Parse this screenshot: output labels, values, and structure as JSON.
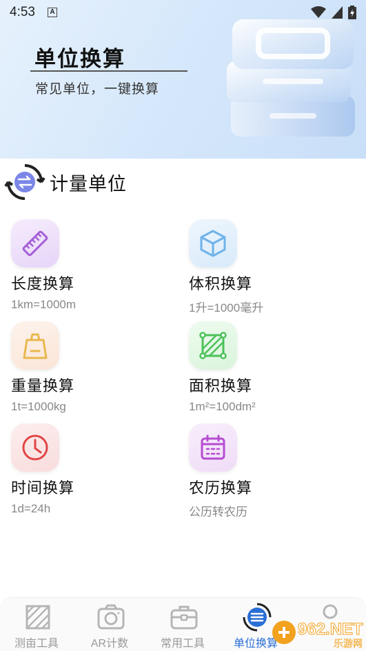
{
  "status_bar": {
    "time": "4:53",
    "notification_icon": "A"
  },
  "hero": {
    "title": "单位换算",
    "subtitle": "常见单位，一键换算"
  },
  "section": {
    "title": "计量单位"
  },
  "tools": [
    {
      "name": "长度换算",
      "desc": "1km=1000m",
      "icon": "ruler-icon",
      "color": "#a45fd6"
    },
    {
      "name": "体积换算",
      "desc": "1升=1000毫升",
      "icon": "cube-icon",
      "color": "#6fb3ea"
    },
    {
      "name": "重量换算",
      "desc": "1t=1000kg",
      "icon": "weight-bag-icon",
      "color": "#e8b84c"
    },
    {
      "name": "面积换算",
      "desc": "1m²=100dm²",
      "icon": "area-square-icon",
      "color": "#4cc25a"
    },
    {
      "name": "时间换算",
      "desc": "1d=24h",
      "icon": "clock-icon",
      "color": "#e04545"
    },
    {
      "name": "农历换算",
      "desc": "公历转农历",
      "icon": "calendar-icon",
      "color": "#b54dd0"
    }
  ],
  "bottom_nav": [
    {
      "label": "测亩工具",
      "icon": "measure-field-icon",
      "active": false
    },
    {
      "label": "AR计数",
      "icon": "camera-icon",
      "active": false
    },
    {
      "label": "常用工具",
      "icon": "toolbox-icon",
      "active": false
    },
    {
      "label": "单位换算",
      "icon": "unit-convert-icon",
      "active": true
    },
    {
      "label": "",
      "icon": "profile-icon",
      "active": false
    }
  ],
  "watermark": {
    "text": "962.NET",
    "sub": "乐游网"
  },
  "colors": {
    "accent": "#2a6fd6",
    "muted_text": "#888888"
  }
}
